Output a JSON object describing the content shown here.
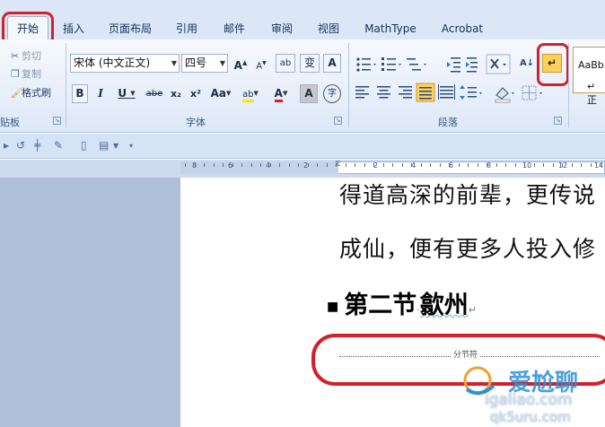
{
  "tabs": [
    {
      "id": "home",
      "label": "开始",
      "active": true
    },
    {
      "id": "insert",
      "label": "插入"
    },
    {
      "id": "layout",
      "label": "页面布局"
    },
    {
      "id": "references",
      "label": "引用"
    },
    {
      "id": "mailings",
      "label": "邮件"
    },
    {
      "id": "review",
      "label": "审阅"
    },
    {
      "id": "view",
      "label": "视图"
    },
    {
      "id": "mathtype",
      "label": "MathType"
    },
    {
      "id": "acrobat",
      "label": "Acrobat"
    }
  ],
  "clipboard": {
    "cut": "剪切",
    "copy": "复制",
    "format_painter": "格式刷",
    "group_label": "贴板"
  },
  "font": {
    "name": "宋体 (中文正文)",
    "size": "四号",
    "group_label": "字体",
    "grow": "A",
    "shrink": "A",
    "clear": "ab",
    "phonetic": "变",
    "border_char": "A",
    "bold": "B",
    "italic": "I",
    "underline": "U",
    "strike": "abe",
    "subscript": "x₂",
    "superscript": "x²",
    "change_case": "Aa",
    "highlight": "ab",
    "color": "A",
    "shade": "A",
    "enclose": "字"
  },
  "paragraph": {
    "group_label": "段落",
    "sort": "A↓",
    "show_marks": "↵"
  },
  "styles": {
    "sample": "AaBb",
    "sub": "↵ 正"
  },
  "ruler": {
    "left_numbers": [
      "8",
      "6",
      "4",
      "2"
    ],
    "right_numbers": [
      "2",
      "4",
      "6",
      "8",
      "10",
      "12",
      "14"
    ]
  },
  "document": {
    "line1": "得道高深的前辈，更传说",
    "line2": "成仙，便有更多人投入修",
    "heading_a": "第二节",
    "heading_b": "歙州",
    "para_mark": "↵",
    "separator_label": "分节符"
  },
  "watermark": {
    "brand": "爱尬聊",
    "url": "igaliao.com",
    "url2": "qk5uru.com"
  },
  "colors": {
    "annotation_red": "#d3202a",
    "ribbon_bg": "#dde8f7",
    "highlight_btn": "#ffd05a",
    "font_color_red": "#e02020"
  }
}
